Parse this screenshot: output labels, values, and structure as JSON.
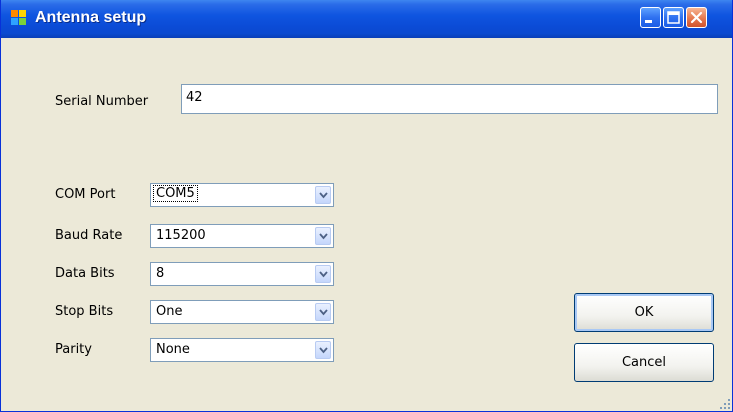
{
  "window": {
    "title": "Antenna setup",
    "icon": "app-icon",
    "controls": [
      "minimize-icon",
      "maximize-icon",
      "close-icon"
    ]
  },
  "serial": {
    "label": "Serial Number",
    "value": "42"
  },
  "settings": [
    {
      "label": "COM Port",
      "value": "COM5",
      "focused": true
    },
    {
      "label": "Baud Rate",
      "value": "115200"
    },
    {
      "label": "Data Bits",
      "value": "8"
    },
    {
      "label": "Stop Bits",
      "value": "One"
    },
    {
      "label": "Parity",
      "value": "None"
    }
  ],
  "buttons": {
    "ok_label": "OK",
    "cancel_label": "Cancel"
  },
  "colors": {
    "titlebar": "#0b4bd6",
    "dialog_bg": "#ece9d8",
    "field_border": "#7f9db9"
  }
}
